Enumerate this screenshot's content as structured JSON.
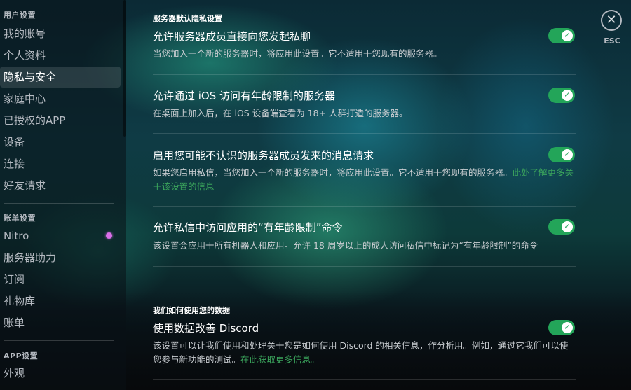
{
  "sidebar": {
    "headers": {
      "user": "用户设置",
      "billing": "账单设置",
      "app": "APP设置"
    },
    "user_items": [
      {
        "label": "我的账号"
      },
      {
        "label": "个人资料"
      },
      {
        "label": "隐私与安全",
        "active": true
      },
      {
        "label": "家庭中心"
      },
      {
        "label": "已授权的APP"
      },
      {
        "label": "设备"
      },
      {
        "label": "连接"
      },
      {
        "label": "好友请求"
      }
    ],
    "billing_items": [
      {
        "label": "Nitro"
      },
      {
        "label": "服务器助力"
      },
      {
        "label": "订阅"
      },
      {
        "label": "礼物库"
      },
      {
        "label": "账单"
      }
    ],
    "app_items": [
      {
        "label": "外观"
      }
    ]
  },
  "main": {
    "section1_title": "服务器默认隐私设置",
    "settings": [
      {
        "title": "允许服务器成员直接向您发起私聊",
        "desc": "当您加入一个新的服务器时，将应用此设置。它不适用于您现有的服务器。",
        "enabled": true
      },
      {
        "title": "允许通过 iOS 访问有年龄限制的服务器",
        "desc": "在桌面上加入后，在 iOS 设备端查看为 18+ 人群打造的服务器。",
        "enabled": true
      },
      {
        "title": "启用您可能不认识的服务器成员发来的消息请求",
        "desc": "如果您启用私信，当您加入一个新的服务器时，将应用此设置。它不适用于您现有的服务器。",
        "link": "此处了解更多关于该设置的信息",
        "enabled": true
      },
      {
        "title": "允许私信中访问应用的“有年龄限制”命令",
        "desc": "该设置会应用于所有机器人和应用。允许 18 周岁以上的成人访问私信中标记为“有年龄限制”的命令",
        "enabled": true
      }
    ],
    "section2_title": "我们如何使用您的数据",
    "data_settings": [
      {
        "title": "使用数据改善 Discord",
        "desc": "该设置可以让我们使用和处理关于您是如何使用 Discord 的相关信息，作分析用。例如，通过它我们可以使您参与新功能的测试。",
        "link": "在此获取更多信息。",
        "enabled": true
      }
    ]
  },
  "close": {
    "icon": "close-icon",
    "label": "ESC"
  },
  "colors": {
    "toggle_on": "#23a559",
    "link": "#3ba55c"
  }
}
